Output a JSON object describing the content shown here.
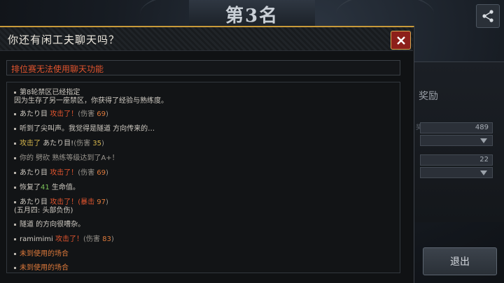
{
  "background": {
    "rank_title": "第3名",
    "reward_label": "奖励",
    "faint_label": "奖励",
    "field1_value": "489",
    "field2_value": "22",
    "exit_label": "退出"
  },
  "modal": {
    "title": "你还有闲工夫聊天吗？",
    "notice": "排位赛无法使用聊天功能"
  },
  "log": {
    "l1a": "第8轮禁区已经指定",
    "l1b": "因为生存了另一座禁区，你获得了经验与熟练度。",
    "l2_name": "あたり目",
    "l2_verb": "攻击了！",
    "l2_dmg_pre": "(伤害",
    "l2_dmg": "69",
    "l2_post": ")",
    "l3": "听到了尖叫声。我觉得是隧道 方向传来的…",
    "l4_verb": "攻击了",
    "l4_name": "あたり目!",
    "l4_dmg_pre": "(伤害",
    "l4_dmg": "35",
    "l4_post": ")",
    "l5": "你的 劈砍 熟练等级达到了A+！",
    "l6_name": "あたり目",
    "l6_verb": "攻击了！",
    "l6_dmg_pre": "(伤害",
    "l6_dmg": "69",
    "l6_post": ")",
    "l7_pre": "恢复了",
    "l7_num": "41",
    "l7_post": "生命值。",
    "l8_name": "あたり目",
    "l8_verb": "攻击了！",
    "l8_dmg_pre": "(暴击",
    "l8_dmg": "97",
    "l8_post": ")",
    "l8b": "(五月四: 头部负伤)",
    "l9": "隧道 的方向很嘈杂。",
    "l10_name": "ramimimi",
    "l10_verb": "攻击了！",
    "l10_dmg_pre": "(伤害",
    "l10_dmg": "83",
    "l10_post": ")",
    "l11": "未到使用的场合",
    "l12": "未到使用的场合"
  },
  "colors": {
    "accent_gold": "#c89a3a",
    "close_red": "#8d1f1a",
    "notice_red": "#e0542e",
    "attack_orange": "#df7a3b",
    "heal_green": "#7cc35a",
    "damage_yellow": "#d6b64c"
  },
  "icons": {
    "share": "share-icon",
    "close": "close-icon",
    "dropdown": "chevron-down-icon"
  }
}
